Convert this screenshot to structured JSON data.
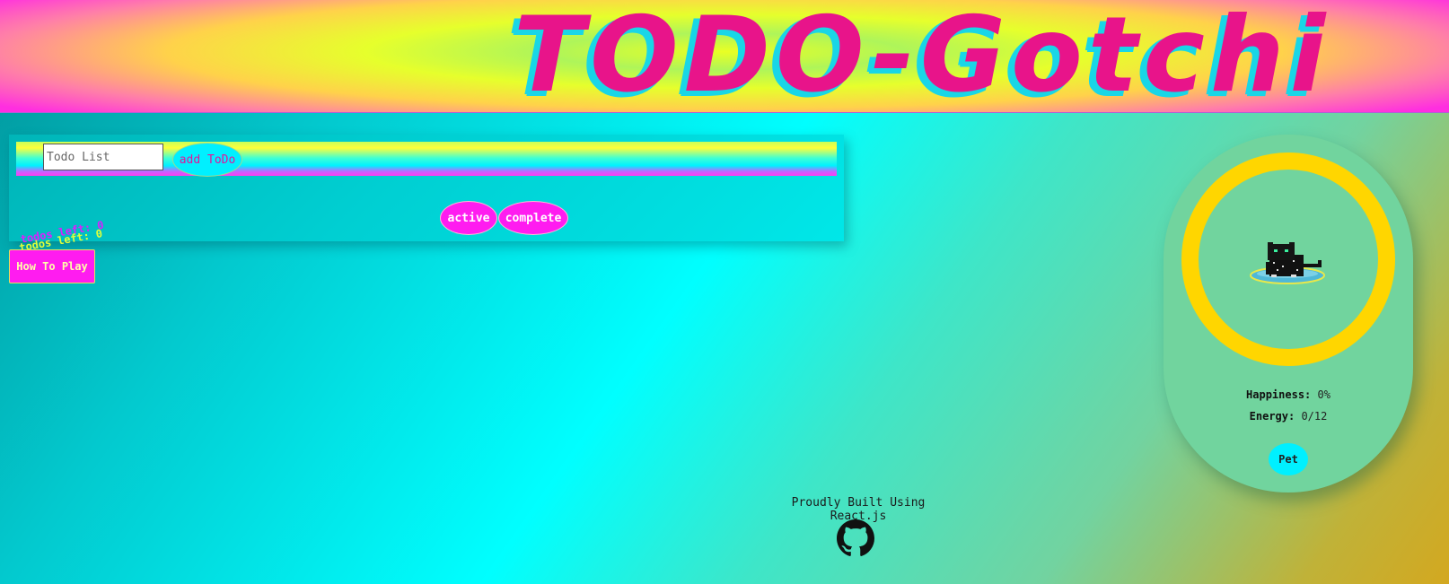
{
  "header": {
    "title": "TODO-Gotchi"
  },
  "todo": {
    "input_placeholder": "Todo List",
    "add_label": "add ToDo",
    "filters": [
      "active",
      "complete"
    ]
  },
  "todos_left": {
    "text": "todos left: 0"
  },
  "how_to_play": {
    "label": "How To Play"
  },
  "pet": {
    "happiness_label": "Happiness:",
    "happiness_value": "0%",
    "energy_label": "Energy:",
    "energy_value": "0/12",
    "pet_button": "Pet"
  },
  "footer": {
    "built_with": "Proudly Built Using React.js",
    "github_icon": "github-icon"
  },
  "colors": {
    "title": "#e8148a",
    "title_shadow": "#19d6e6",
    "button_magenta": "#ff1cf0",
    "button_cyan": "#00f0ff",
    "ring": "#ffd600",
    "pet_panel": "#71d49e"
  }
}
